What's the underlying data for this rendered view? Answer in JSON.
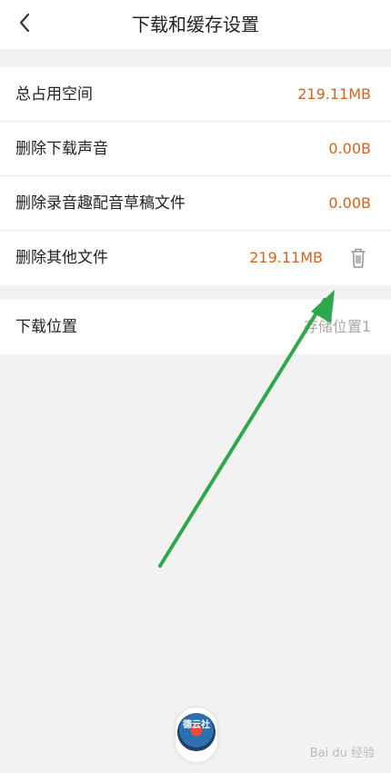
{
  "header": {
    "title": "下载和缓存设置"
  },
  "storage": {
    "rows": [
      {
        "label": "总占用空间",
        "value": "219.11MB"
      },
      {
        "label": "删除下载声音",
        "value": "0.00B"
      },
      {
        "label": "删除录音趣配音草稿文件",
        "value": "0.00B"
      },
      {
        "label": "删除其他文件",
        "value": "219.11MB"
      }
    ]
  },
  "location": {
    "label": "下载位置",
    "value": "存储位置1"
  },
  "mini_player": {
    "cover_text": "德云社"
  },
  "watermark": "Bai du 经验",
  "colors": {
    "accent": "#d7621b",
    "arrow": "#2ea84a"
  },
  "icons": {
    "back": "chevron-left-icon",
    "delete": "trash-icon"
  }
}
